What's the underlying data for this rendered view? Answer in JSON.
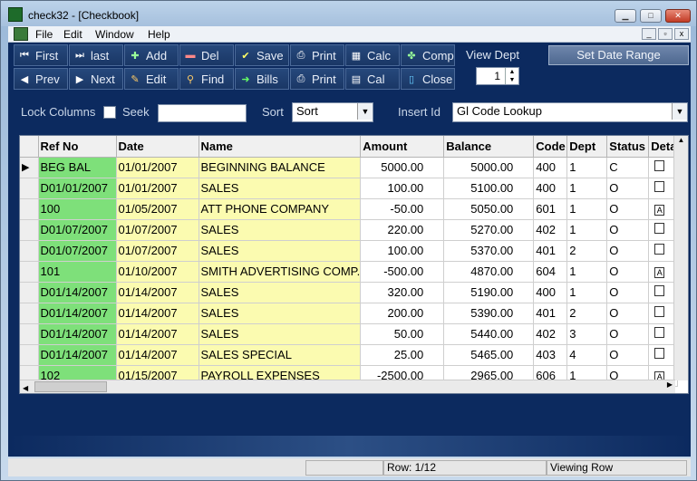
{
  "window": {
    "title": "check32 - [Checkbook]"
  },
  "menu": {
    "items": [
      "File",
      "Edit",
      "Window",
      "Help"
    ]
  },
  "toolbar": {
    "row1": [
      {
        "label": "First",
        "icon": "first-icon"
      },
      {
        "label": "last",
        "icon": "last-icon"
      },
      {
        "label": "Add",
        "icon": "add-icon"
      },
      {
        "label": "Del",
        "icon": "delete-icon"
      },
      {
        "label": "Save",
        "icon": "save-icon"
      },
      {
        "label": "Print",
        "icon": "print-icon"
      },
      {
        "label": "Calc",
        "icon": "calculator-icon"
      },
      {
        "label": "Comp",
        "icon": "compare-icon"
      }
    ],
    "row2": [
      {
        "label": "Prev",
        "icon": "prev-icon"
      },
      {
        "label": "Next",
        "icon": "next-icon"
      },
      {
        "label": "Edit",
        "icon": "edit-icon"
      },
      {
        "label": "Find",
        "icon": "find-icon"
      },
      {
        "label": "Bills",
        "icon": "bills-icon"
      },
      {
        "label": "Print",
        "icon": "print-icon"
      },
      {
        "label": "Cal",
        "icon": "calendar-icon"
      },
      {
        "label": "Close",
        "icon": "close-icon"
      }
    ]
  },
  "view_dept": {
    "label": "View Dept",
    "value": "1"
  },
  "set_date_range": "Set Date Range",
  "filters": {
    "lock_columns": "Lock Columns",
    "seek": "Seek",
    "sort_label": "Sort",
    "sort_value": "Sort",
    "insert_id": "Insert Id",
    "insert_value": "Gl Code Lookup"
  },
  "table": {
    "columns": [
      "Ref No",
      "Date",
      "Name",
      "Amount",
      "Balance",
      "Code",
      "Dept",
      "Status",
      "Deta"
    ],
    "rows": [
      [
        "BEG BAL",
        "01/01/2007",
        "BEGINNING BALANCE",
        "5000.00",
        "5000.00",
        "400",
        "1",
        "C",
        "box"
      ],
      [
        "D01/01/2007",
        "01/01/2007",
        "SALES",
        "100.00",
        "5100.00",
        "400",
        "1",
        "O",
        "box"
      ],
      [
        "100",
        "01/05/2007",
        "ATT PHONE COMPANY",
        "-50.00",
        "5050.00",
        "601",
        "1",
        "O",
        "a"
      ],
      [
        "D01/07/2007",
        "01/07/2007",
        "SALES",
        "220.00",
        "5270.00",
        "402",
        "1",
        "O",
        "box"
      ],
      [
        "D01/07/2007",
        "01/07/2007",
        "SALES",
        "100.00",
        "5370.00",
        "401",
        "2",
        "O",
        "box"
      ],
      [
        "101",
        "01/10/2007",
        "SMITH ADVERTISING COMP.",
        "-500.00",
        "4870.00",
        "604",
        "1",
        "O",
        "a"
      ],
      [
        "D01/14/2007",
        "01/14/2007",
        "SALES",
        "320.00",
        "5190.00",
        "400",
        "1",
        "O",
        "box"
      ],
      [
        "D01/14/2007",
        "01/14/2007",
        "SALES",
        "200.00",
        "5390.00",
        "401",
        "2",
        "O",
        "box"
      ],
      [
        "D01/14/2007",
        "01/14/2007",
        "SALES",
        "50.00",
        "5440.00",
        "402",
        "3",
        "O",
        "box"
      ],
      [
        "D01/14/2007",
        "01/14/2007",
        "SALES SPECIAL",
        "25.00",
        "5465.00",
        "403",
        "4",
        "O",
        "box"
      ],
      [
        "102",
        "01/15/2007",
        "PAYROLL EXPENSES",
        "-2500.00",
        "2965.00",
        "606",
        "1",
        "O",
        "a"
      ]
    ]
  },
  "status": {
    "row": "Row: 1/12",
    "mode": "Viewing Row"
  }
}
